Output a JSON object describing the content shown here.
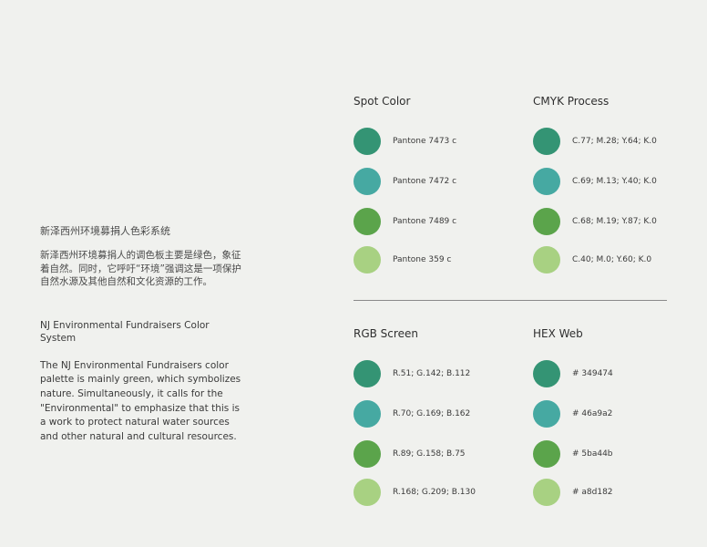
{
  "colors": {
    "dark_green": "#349474",
    "teal": "#46a9a2",
    "green": "#5ba44b",
    "light_green": "#a8d182"
  },
  "intro": {
    "cn_title": "新泽西州环境募捐人色彩系统",
    "cn_body": "新泽西州环境募捐人的调色板主要是绿色，象征着自然。同时，它呼吁“环境”强调这是一项保护自然水源及其他自然和文化资源的工作。",
    "en_title": "NJ Environmental Fundraisers Color System",
    "en_body": "The NJ Environmental Fundraisers color palette is mainly green, which symbolizes nature. Simultaneously, it calls for the \"Environmental\" to emphasize that this is a work to protect natural water sources and other natural and cultural resources."
  },
  "spot": {
    "title": "Spot Color",
    "items": [
      "Pantone 7473 c",
      "Pantone 7472 c",
      "Pantone 7489 c",
      "Pantone 359 c"
    ]
  },
  "cmyk": {
    "title": "CMYK Process",
    "items": [
      "C.77; M.28; Y.64; K.0",
      "C.69; M.13; Y.40; K.0",
      "C.68; M.19; Y.87; K.0",
      "C.40; M.0; Y.60; K.0"
    ]
  },
  "rgb": {
    "title": "RGB Screen",
    "items": [
      "R.51;  G.142;  B.112",
      "R.70;  G.169;  B.162",
      "R.89;  G.158;  B.75",
      "R.168;  G.209;  B.130"
    ]
  },
  "hex": {
    "title": "HEX Web",
    "items": [
      "# 349474",
      "# 46a9a2",
      "# 5ba44b",
      "# a8d182"
    ]
  }
}
